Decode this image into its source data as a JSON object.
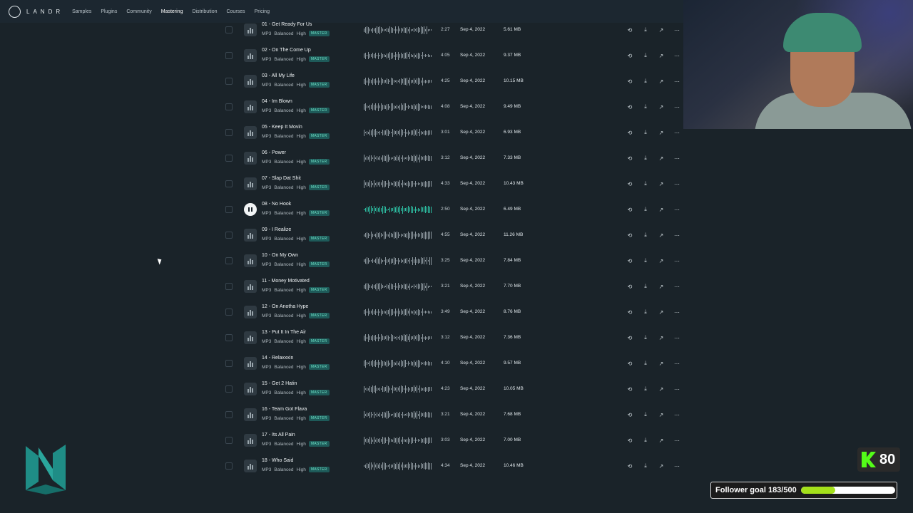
{
  "app": {
    "logo_text": "LANDR"
  },
  "nav": {
    "items": [
      {
        "label": "Samples",
        "active": false
      },
      {
        "label": "Plugins",
        "active": false
      },
      {
        "label": "Community",
        "active": false
      },
      {
        "label": "Mastering",
        "active": true
      },
      {
        "label": "Distribution",
        "active": false
      },
      {
        "label": "Courses",
        "active": false
      },
      {
        "label": "Pricing",
        "active": false
      }
    ]
  },
  "tracks": [
    {
      "title": "01 - Get Ready For Us",
      "format": "MP3",
      "style": "Balanced",
      "intensity": "High",
      "badge": "MASTER",
      "duration": "2:27",
      "date": "Sep 4, 2022",
      "size": "5.61 MB",
      "playing": false
    },
    {
      "title": "02 - On The Come Up",
      "format": "MP3",
      "style": "Balanced",
      "intensity": "High",
      "badge": "MASTER",
      "duration": "4:05",
      "date": "Sep 4, 2022",
      "size": "9.37 MB",
      "playing": false
    },
    {
      "title": "03 - All My Life",
      "format": "MP3",
      "style": "Balanced",
      "intensity": "High",
      "badge": "MASTER",
      "duration": "4:25",
      "date": "Sep 4, 2022",
      "size": "10.15 MB",
      "playing": false
    },
    {
      "title": "04 - Im Blown",
      "format": "MP3",
      "style": "Balanced",
      "intensity": "High",
      "badge": "MASTER",
      "duration": "4:08",
      "date": "Sep 4, 2022",
      "size": "9.49 MB",
      "playing": false
    },
    {
      "title": "05 - Keep It Movin",
      "format": "MP3",
      "style": "Balanced",
      "intensity": "High",
      "badge": "MASTER",
      "duration": "3:01",
      "date": "Sep 4, 2022",
      "size": "6.93 MB",
      "playing": false
    },
    {
      "title": "06 - Power",
      "format": "MP3",
      "style": "Balanced",
      "intensity": "High",
      "badge": "MASTER",
      "duration": "3:12",
      "date": "Sep 4, 2022",
      "size": "7.33 MB",
      "playing": false
    },
    {
      "title": "07 - Slap Dat Shit",
      "format": "MP3",
      "style": "Balanced",
      "intensity": "High",
      "badge": "MASTER",
      "duration": "4:33",
      "date": "Sep 4, 2022",
      "size": "10.43 MB",
      "playing": false
    },
    {
      "title": "08 - No Hook",
      "format": "MP3",
      "style": "Balanced",
      "intensity": "High",
      "badge": "MASTER",
      "duration": "2:50",
      "date": "Sep 4, 2022",
      "size": "6.49 MB",
      "playing": true
    },
    {
      "title": "09 - I Realize",
      "format": "MP3",
      "style": "Balanced",
      "intensity": "High",
      "badge": "MASTER",
      "duration": "4:55",
      "date": "Sep 4, 2022",
      "size": "11.26 MB",
      "playing": false
    },
    {
      "title": "10 - On My Own",
      "format": "MP3",
      "style": "Balanced",
      "intensity": "High",
      "badge": "MASTER",
      "duration": "3:25",
      "date": "Sep 4, 2022",
      "size": "7.84 MB",
      "playing": false
    },
    {
      "title": "11 - Money Motivated",
      "format": "MP3",
      "style": "Balanced",
      "intensity": "High",
      "badge": "MASTER",
      "duration": "3:21",
      "date": "Sep 4, 2022",
      "size": "7.70 MB",
      "playing": false
    },
    {
      "title": "12 - On Anotha Hype",
      "format": "MP3",
      "style": "Balanced",
      "intensity": "High",
      "badge": "MASTER",
      "duration": "3:49",
      "date": "Sep 4, 2022",
      "size": "8.76 MB",
      "playing": false
    },
    {
      "title": "13 - Put It In The Air",
      "format": "MP3",
      "style": "Balanced",
      "intensity": "High",
      "badge": "MASTER",
      "duration": "3:12",
      "date": "Sep 4, 2022",
      "size": "7.36 MB",
      "playing": false
    },
    {
      "title": "14 - Relaxxxin",
      "format": "MP3",
      "style": "Balanced",
      "intensity": "High",
      "badge": "MASTER",
      "duration": "4:10",
      "date": "Sep 4, 2022",
      "size": "9.57 MB",
      "playing": false
    },
    {
      "title": "15 - Get 2 Hatin",
      "format": "MP3",
      "style": "Balanced",
      "intensity": "High",
      "badge": "MASTER",
      "duration": "4:23",
      "date": "Sep 4, 2022",
      "size": "10.05 MB",
      "playing": false
    },
    {
      "title": "16 - Team Got Flava",
      "format": "MP3",
      "style": "Balanced",
      "intensity": "High",
      "badge": "MASTER",
      "duration": "3:21",
      "date": "Sep 4, 2022",
      "size": "7.68 MB",
      "playing": false
    },
    {
      "title": "17 - Its All Pain",
      "format": "MP3",
      "style": "Balanced",
      "intensity": "High",
      "badge": "MASTER",
      "duration": "3:03",
      "date": "Sep 4, 2022",
      "size": "7.00 MB",
      "playing": false
    },
    {
      "title": "18 - Who Said",
      "format": "MP3",
      "style": "Balanced",
      "intensity": "High",
      "badge": "MASTER",
      "duration": "4:34",
      "date": "Sep 4, 2022",
      "size": "10.46 MB",
      "playing": false
    }
  ],
  "row_actions": [
    "revise-icon",
    "download-icon",
    "share-icon",
    "more-icon"
  ],
  "overlay": {
    "kick_count": "80",
    "follower_goal_text": "Follower goal 183/500",
    "follower_goal_progress": 0.366
  },
  "colors": {
    "accent": "#2dbfa3",
    "badge_bg": "#1e5a59",
    "badge_text": "#6fe3c7",
    "kick_green": "#53fc18",
    "goal_fill": "#a4e01a"
  }
}
